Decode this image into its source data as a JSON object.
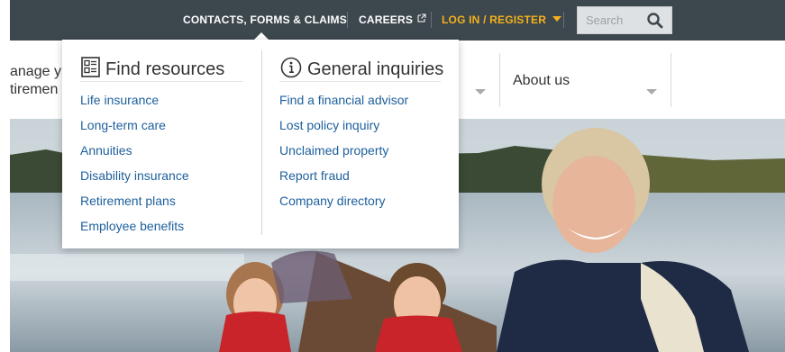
{
  "topbar": {
    "contacts": "CONTACTS, FORMS & CLAIMS",
    "careers": "CAREERS",
    "careers_icon": "external-link-icon",
    "login": "LOG IN / REGISTER",
    "search_placeholder": "Search",
    "search_icon": "search-icon",
    "colors": {
      "bar": "#3d474e",
      "login": "#f5b21b"
    }
  },
  "mainnav": {
    "partial_text_line1": "anage y",
    "partial_text_line2": "tiremen",
    "about": "About us"
  },
  "dropdown": {
    "find_resources": {
      "icon": "document-list-icon",
      "title": "Find resources",
      "links": [
        "Life insurance",
        "Long-term care",
        "Annuities",
        "Disability insurance",
        "Retirement plans",
        "Employee benefits"
      ]
    },
    "general_inquiries": {
      "icon": "info-circle-icon",
      "title": "General inquiries",
      "links": [
        "Find a financial advisor",
        "Lost policy inquiry",
        "Unclaimed property",
        "Report fraud",
        "Company directory"
      ]
    },
    "link_color": "#1d5f9c"
  }
}
